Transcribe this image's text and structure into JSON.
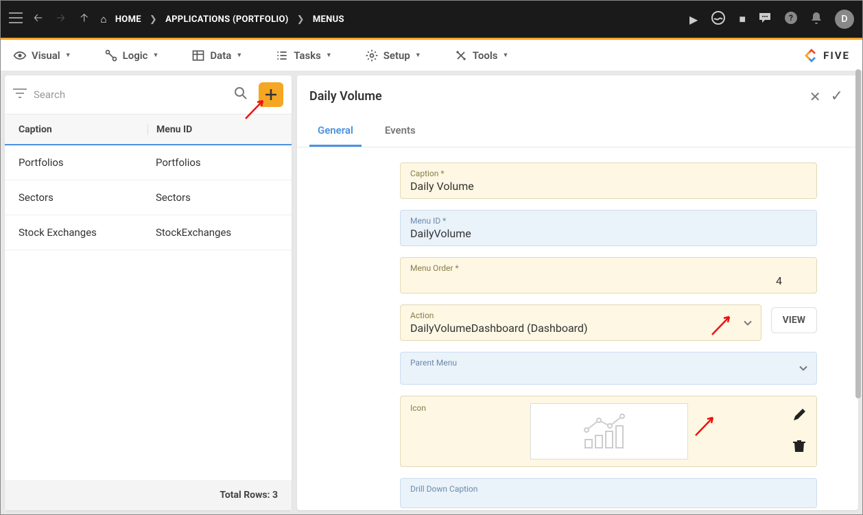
{
  "topbar": {
    "breadcrumb": {
      "home": "HOME",
      "apps": "APPLICATIONS (PORTFOLIO)",
      "menus": "MENUS"
    },
    "avatar": "D"
  },
  "menubar": {
    "visual": "Visual",
    "logic": "Logic",
    "data": "Data",
    "tasks": "Tasks",
    "setup": "Setup",
    "tools": "Tools",
    "brand": "FIVE"
  },
  "leftPanel": {
    "search_placeholder": "Search",
    "headers": {
      "caption": "Caption",
      "menu_id": "Menu ID"
    },
    "rows": [
      {
        "caption": "Portfolios",
        "menu_id": "Portfolios"
      },
      {
        "caption": "Sectors",
        "menu_id": "Sectors"
      },
      {
        "caption": "Stock Exchanges",
        "menu_id": "StockExchanges"
      }
    ],
    "footer": "Total Rows: 3"
  },
  "rightPanel": {
    "title": "Daily Volume",
    "tabs": {
      "general": "General",
      "events": "Events"
    },
    "fields": {
      "caption_label": "Caption *",
      "caption_value": "Daily Volume",
      "menuid_label": "Menu ID *",
      "menuid_value": "DailyVolume",
      "order_label": "Menu Order *",
      "order_value": "4",
      "action_label": "Action",
      "action_value": "DailyVolumeDashboard (Dashboard)",
      "view_btn": "VIEW",
      "parent_label": "Parent Menu",
      "parent_value": "",
      "icon_label": "Icon",
      "drill_label": "Drill Down Caption",
      "drill_value": ""
    }
  }
}
